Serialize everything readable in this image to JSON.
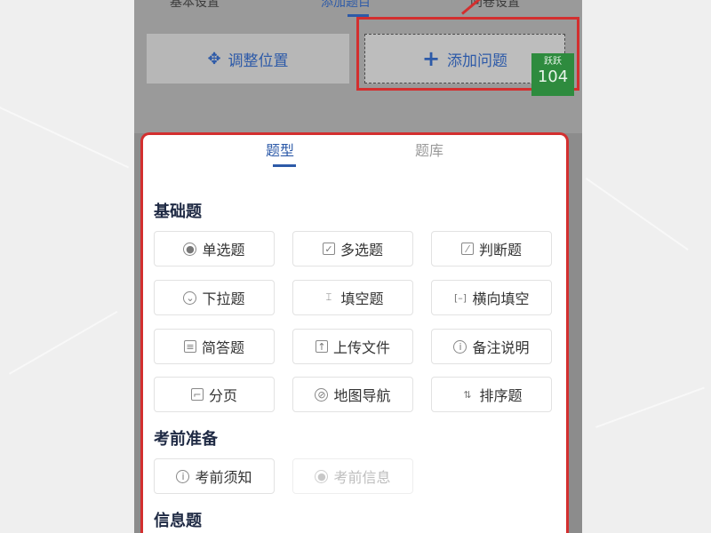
{
  "top_tabs": [
    "基本设置",
    "添加题目",
    "问卷设置"
  ],
  "actions": {
    "adjust_label": "调整位置",
    "add_label": "添加问题"
  },
  "badge": {
    "line1": "跃跃",
    "value": "104"
  },
  "sheet_tabs": {
    "active": "题型",
    "inactive": "题库"
  },
  "sections": [
    {
      "title": "基础题",
      "items": [
        {
          "label": "单选题",
          "icon": "radio-icon"
        },
        {
          "label": "多选题",
          "icon": "checkbox-icon"
        },
        {
          "label": "判断题",
          "icon": "judge-icon"
        },
        {
          "label": "下拉题",
          "icon": "dropdown-icon"
        },
        {
          "label": "填空题",
          "icon": "text-cursor-icon"
        },
        {
          "label": "横向填空",
          "icon": "bracket-icon"
        },
        {
          "label": "简答题",
          "icon": "document-icon"
        },
        {
          "label": "上传文件",
          "icon": "upload-folder-icon"
        },
        {
          "label": "备注说明",
          "icon": "info-icon"
        },
        {
          "label": "分页",
          "icon": "page-icon"
        },
        {
          "label": "地图导航",
          "icon": "compass-icon"
        },
        {
          "label": "排序题",
          "icon": "sort-icon"
        }
      ]
    },
    {
      "title": "考前准备",
      "items": [
        {
          "label": "考前须知",
          "icon": "info-icon"
        },
        {
          "label": "考前信息",
          "icon": "user-icon",
          "disabled": true
        }
      ]
    },
    {
      "title": "信息题",
      "items": []
    }
  ]
}
